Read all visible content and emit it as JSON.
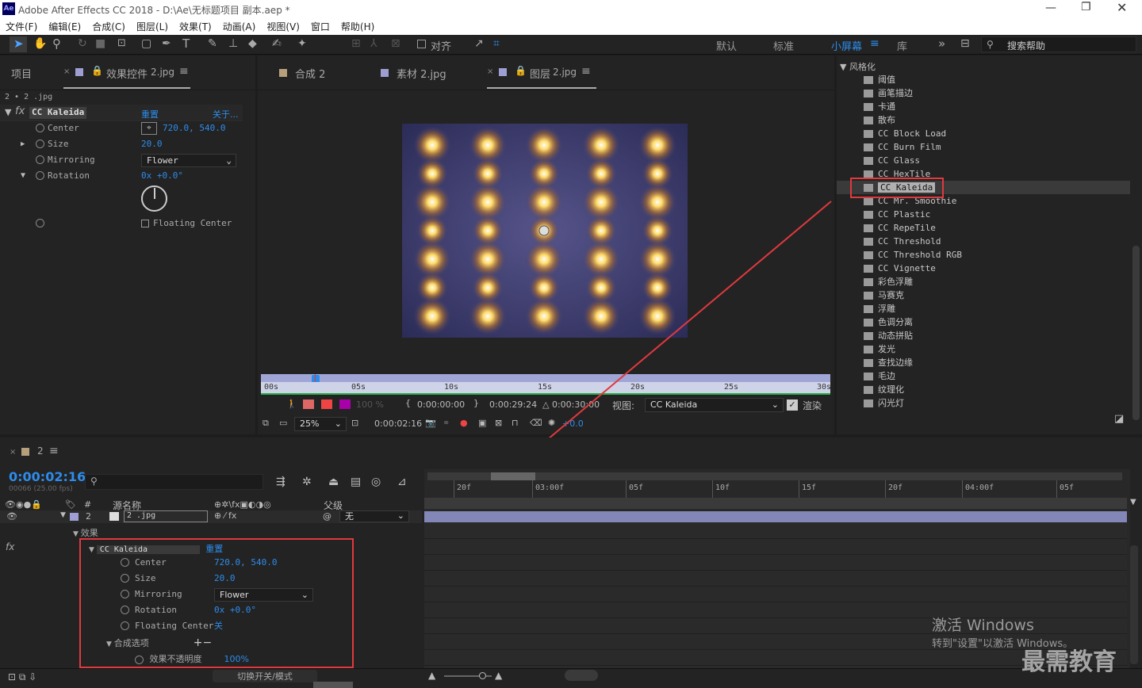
{
  "window": {
    "title": "Adobe After Effects CC 2018 - D:\\Ae\\无标题项目 副本.aep *",
    "app_icon": "Ae"
  },
  "menu": [
    "文件(F)",
    "编辑(E)",
    "合成(C)",
    "图层(L)",
    "效果(T)",
    "动画(A)",
    "视图(V)",
    "窗口",
    "帮助(H)"
  ],
  "toolbar": {
    "snap_label": "对齐",
    "workspaces": [
      "默认",
      "标准",
      "小屏幕",
      "库"
    ],
    "active_workspace": "小屏幕",
    "search_placeholder": "搜索帮助"
  },
  "left_panel": {
    "tab_project": "项目",
    "tab_effects": "效果控件",
    "tab_effects_layer": "2.jpg",
    "breadcrumb": "2 • 2 .jpg",
    "effect_name": "CC Kaleida",
    "reset": "重置",
    "about": "关于...",
    "props": [
      {
        "name": "Center",
        "value": "720.0, 540.0"
      },
      {
        "name": "Size",
        "value": "20.0"
      },
      {
        "name": "Mirroring",
        "value": "Flower"
      },
      {
        "name": "Rotation",
        "value": "0x +0.0°"
      }
    ],
    "floating_center": "Floating Center"
  },
  "viewer": {
    "tab_comp": "合成 2",
    "tab_footage": "素材 2.jpg",
    "tab_layer": "图层",
    "tab_layer_name": "2.jpg",
    "ruler": [
      "00s",
      "05s",
      "10s",
      "15s",
      "20s",
      "25s",
      "30s"
    ],
    "time_start": "0:00:00:00",
    "time_end": "0:00:29:24",
    "duration": "△ 0:00:30:00",
    "view_label": "视图:",
    "view_value": "CC Kaleida",
    "render_label": "渲染",
    "zoom": "25%",
    "current_time": "0:00:02:16",
    "exposure": "+0.0",
    "opacity_label": "100 %"
  },
  "effects_panel": {
    "category": "风格化",
    "items": [
      "阈值",
      "画笔描边",
      "卡通",
      "散布",
      "CC Block Load",
      "CC Burn Film",
      "CC Glass",
      "CC HexTile",
      "CC Kaleida",
      "CC Mr. Smoothie",
      "CC Plastic",
      "CC RepeTile",
      "CC Threshold",
      "CC Threshold RGB",
      "CC Vignette",
      "彩色浮雕",
      "马赛克",
      "浮雕",
      "色调分离",
      "动态拼贴",
      "发光",
      "查找边缘",
      "毛边",
      "纹理化",
      "闪光灯"
    ],
    "selected": "CC Kaleida"
  },
  "timeline": {
    "tab": "2",
    "timecode": "0:00:02:16",
    "fps": "00066 (25.00 fps)",
    "col_num": "#",
    "col_source": "源名称",
    "col_parent": "父级",
    "layer_num": "2",
    "layer_name": "2 .jpg",
    "parent_value": "无",
    "effects_group": "效果",
    "effect_name": "CC Kaleida",
    "reset": "重置",
    "props": [
      {
        "name": "Center",
        "value": "720.0, 540.0"
      },
      {
        "name": "Size",
        "value": "20.0"
      },
      {
        "name": "Mirroring",
        "value": "Flower"
      },
      {
        "name": "Rotation",
        "value": "0x +0.0°"
      },
      {
        "name": "Floating Center",
        "value": "关"
      }
    ],
    "composite_options": "合成选项",
    "effect_opacity_label": "效果不透明度",
    "effect_opacity": "100%",
    "ruler": [
      "20f",
      "03:00f",
      "05f",
      "10f",
      "15f",
      "20f",
      "04:00f",
      "05f"
    ],
    "toggle_modes": "切换开关/模式"
  },
  "overlay": {
    "watermark_line1": "激活 Windows",
    "watermark_line2": "转到\"设置\"以激活 Windows。",
    "brand": "最需教育"
  },
  "colors": {
    "accent_blue": "#2d8ceb",
    "highlight_red": "#e0393e",
    "panel_bg": "#232323"
  }
}
